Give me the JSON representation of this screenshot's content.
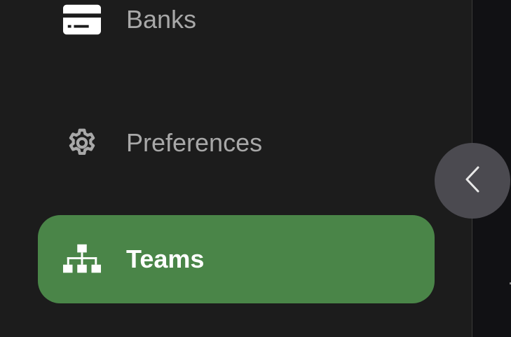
{
  "sidebar": {
    "items": [
      {
        "label": "Banks",
        "icon": "credit-card-icon",
        "active": false
      },
      {
        "label": "Preferences",
        "icon": "gear-icon",
        "active": false
      },
      {
        "label": "Teams",
        "icon": "org-chart-icon",
        "active": true
      }
    ]
  },
  "collapse_button": {
    "icon": "chevron-left-icon"
  },
  "colors": {
    "sidebar_bg": "#1c1c1c",
    "active_bg": "#4a8548",
    "inactive_text": "#a8a8a8",
    "active_text": "#ffffff",
    "collapse_bg": "#4b4a50"
  }
}
